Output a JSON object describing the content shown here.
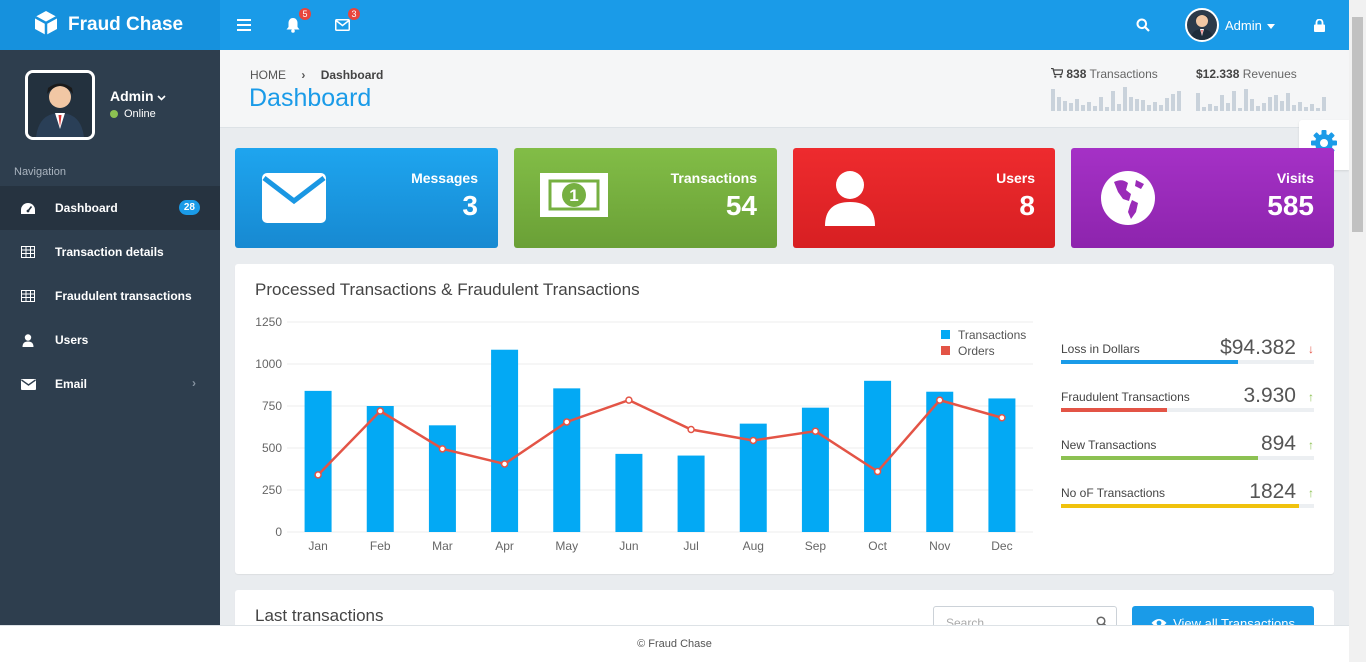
{
  "brand": {
    "name": "Fraud Chase"
  },
  "topbar": {
    "notifications_count": "5",
    "messages_count": "3",
    "user_name": "Admin"
  },
  "sidebar": {
    "user_name": "Admin",
    "status": "Online",
    "nav_title": "Navigation",
    "items": [
      {
        "label": "Dashboard",
        "icon": "dashboard-icon",
        "badge": "28"
      },
      {
        "label": "Transaction details",
        "icon": "table-icon"
      },
      {
        "label": "Fraudulent transactions",
        "icon": "table-icon"
      },
      {
        "label": "Users",
        "icon": "user-icon"
      },
      {
        "label": "Email",
        "icon": "envelope-icon"
      }
    ]
  },
  "header": {
    "breadcrumb_home": "HOME",
    "breadcrumb_current": "Dashboard",
    "title": "Dashboard",
    "stat_transactions_value": "838",
    "stat_transactions_label": "Transactions",
    "stat_revenues_value": "$12.338",
    "stat_revenues_label": "Revenues"
  },
  "tiles": [
    {
      "label": "Messages",
      "value": "3",
      "color": "#1a9be8",
      "icon": "envelope-icon"
    },
    {
      "label": "Transactions",
      "value": "54",
      "color": "#76b041",
      "icon": "money-icon"
    },
    {
      "label": "Users",
      "value": "8",
      "color": "#e3272a",
      "icon": "user-icon"
    },
    {
      "label": "Visits",
      "value": "585",
      "color": "#9a2bb8",
      "icon": "globe-icon"
    }
  ],
  "chart_panel": {
    "title": "Processed Transactions & Fraudulent Transactions",
    "kpis": [
      {
        "label": "Loss in Dollars",
        "value": "$94.382",
        "arrow": "down",
        "fill": 0.7,
        "color": "#1a9be8"
      },
      {
        "label": "Fraudulent Transactions",
        "value": "3.930",
        "arrow": "up",
        "fill": 0.42,
        "color": "#e35446"
      },
      {
        "label": "New Transactions",
        "value": "894",
        "arrow": "up",
        "fill": 0.78,
        "color": "#8cc152"
      },
      {
        "label": "No oF Transactions",
        "value": "1824",
        "arrow": "up",
        "fill": 0.94,
        "color": "#f0c20d"
      }
    ]
  },
  "chart_data": {
    "type": "bar",
    "categories": [
      "Jan",
      "Feb",
      "Mar",
      "Apr",
      "May",
      "Jun",
      "Jul",
      "Aug",
      "Sep",
      "Oct",
      "Nov",
      "Dec"
    ],
    "series": [
      {
        "name": "Transactions",
        "type": "bar",
        "color": "#03a9f4",
        "values": [
          840,
          750,
          635,
          1085,
          855,
          465,
          455,
          645,
          740,
          900,
          835,
          795
        ]
      },
      {
        "name": "Orders",
        "type": "line",
        "color": "#e35446",
        "values": [
          340,
          720,
          495,
          405,
          655,
          785,
          610,
          545,
          600,
          360,
          785,
          680
        ]
      }
    ],
    "ylim": [
      0,
      1250
    ],
    "yticks": [
      0,
      250,
      500,
      750,
      1000,
      1250
    ],
    "legend": "top-right",
    "grid": true
  },
  "last_panel": {
    "title": "Last transactions",
    "search_placeholder": "Search...",
    "view_all_label": "View all Transactions"
  },
  "footer": {
    "text": "© Fraud Chase"
  }
}
